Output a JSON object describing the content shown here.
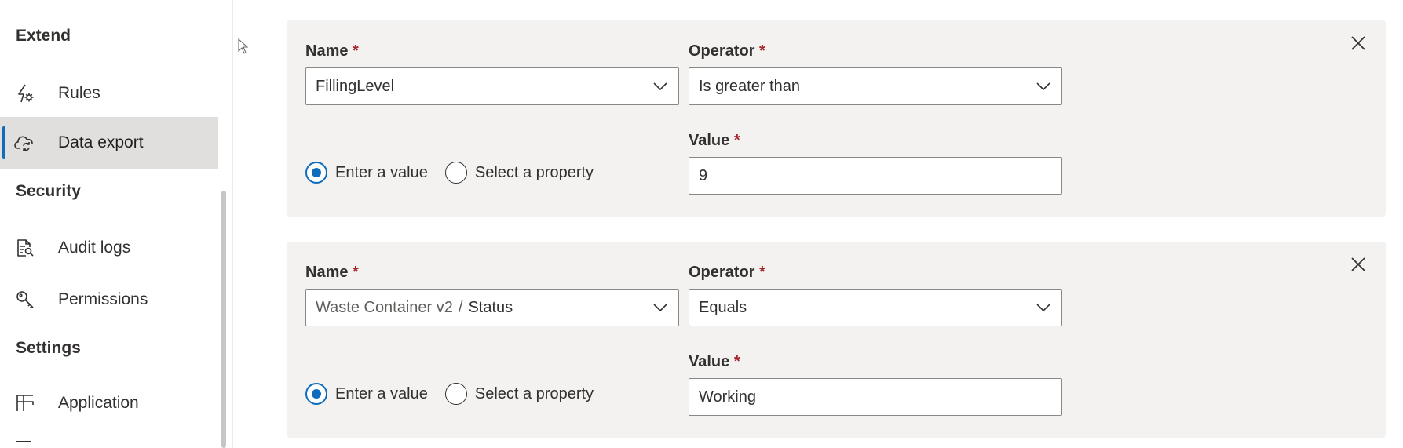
{
  "sidebar": {
    "sections": {
      "extend": "Extend",
      "security": "Security",
      "settings": "Settings"
    },
    "items": {
      "rules": {
        "label": "Rules",
        "icon": "rules-icon"
      },
      "data_export": {
        "label": "Data export",
        "icon": "data-export-icon",
        "selected": true
      },
      "audit_logs": {
        "label": "Audit logs",
        "icon": "audit-logs-icon"
      },
      "permissions": {
        "label": "Permissions",
        "icon": "permissions-icon"
      },
      "application": {
        "label": "Application",
        "icon": "application-icon"
      }
    }
  },
  "filters": [
    {
      "name_label": "Name",
      "operator_label": "Operator",
      "value_label": "Value",
      "required_mark": "*",
      "name_value": "FillingLevel",
      "operator_value": "Is greater than",
      "radio_enter": "Enter a value",
      "radio_select": "Select a property",
      "value": "9"
    },
    {
      "name_label": "Name",
      "operator_label": "Operator",
      "value_label": "Value",
      "required_mark": "*",
      "name_prefix": "Waste Container v2",
      "name_separator": "/",
      "name_value": "Status",
      "operator_value": "Equals",
      "radio_enter": "Enter a value",
      "radio_select": "Select a property",
      "value": "Working"
    }
  ],
  "colors": {
    "accent": "#0f6cbd",
    "required": "#a4262c",
    "card_bg": "#f3f2f1",
    "selected_nav_bg": "#e1dfdd"
  }
}
